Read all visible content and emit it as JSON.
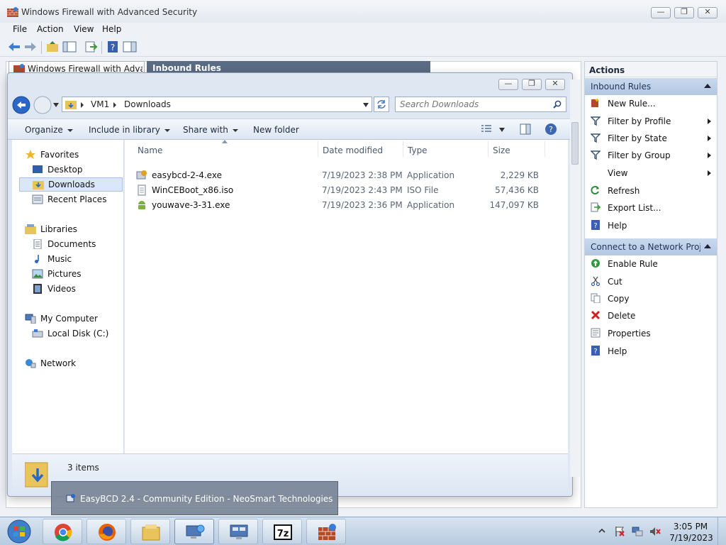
{
  "mmc": {
    "title": "Windows Firewall with Advanced Security",
    "menu": [
      "File",
      "Action",
      "View",
      "Help"
    ],
    "tabs": [
      "Windows Firewall with Advance",
      "Inbound Rules"
    ]
  },
  "actions": {
    "header": "Actions",
    "sections": [
      {
        "title": "Inbound Rules",
        "items": [
          {
            "label": "New Rule...",
            "icon": "new-rule-icon"
          },
          {
            "label": "Filter by Profile",
            "icon": "filter-icon",
            "submenu": true
          },
          {
            "label": "Filter by State",
            "icon": "filter-icon",
            "submenu": true
          },
          {
            "label": "Filter by Group",
            "icon": "filter-icon",
            "submenu": true
          },
          {
            "label": "View",
            "icon": "",
            "submenu": true
          },
          {
            "label": "Refresh",
            "icon": "refresh-icon"
          },
          {
            "label": "Export List...",
            "icon": "export-icon"
          },
          {
            "label": "Help",
            "icon": "help-icon"
          }
        ]
      },
      {
        "title": "Connect to a Network Proj...",
        "items": [
          {
            "label": "Enable Rule",
            "icon": "enable-icon"
          },
          {
            "label": "Cut",
            "icon": "cut-icon"
          },
          {
            "label": "Copy",
            "icon": "copy-icon"
          },
          {
            "label": "Delete",
            "icon": "delete-icon"
          },
          {
            "label": "Properties",
            "icon": "properties-icon"
          },
          {
            "label": "Help",
            "icon": "help-icon"
          }
        ]
      }
    ]
  },
  "explorer": {
    "breadcrumb": [
      "VM1",
      "Downloads"
    ],
    "search_placeholder": "Search Downloads",
    "commands": {
      "organize": "Organize",
      "include": "Include in library",
      "share": "Share with",
      "new_folder": "New folder"
    },
    "nav": {
      "favorites": "Favorites",
      "desktop": "Desktop",
      "downloads": "Downloads",
      "recent": "Recent Places",
      "libraries": "Libraries",
      "documents": "Documents",
      "music": "Music",
      "pictures": "Pictures",
      "videos": "Videos",
      "computer": "My Computer",
      "local_disk": "Local Disk (C:)",
      "network": "Network"
    },
    "columns": {
      "name": "Name",
      "date": "Date modified",
      "type": "Type",
      "size": "Size"
    },
    "files": [
      {
        "name": "easybcd-2-4.exe",
        "date": "7/19/2023 2:38 PM",
        "type": "Application",
        "size": "2,229 KB"
      },
      {
        "name": "WinCEBoot_x86.iso",
        "date": "7/19/2023 2:43 PM",
        "type": "ISO File",
        "size": "57,436 KB"
      },
      {
        "name": "youwave-3-31.exe",
        "date": "7/19/2023 2:36 PM",
        "type": "Application",
        "size": "147,097 KB"
      }
    ],
    "item_count": "3 items"
  },
  "preview": {
    "title": "EasyBCD 2.4 - Community Edition - NeoSmart Technologies"
  },
  "taskbar": {
    "apps": [
      "chrome-icon",
      "firefox-icon",
      "explorer-icon",
      "network-tool-icon",
      "remote-desktop-icon",
      "7zip-icon",
      "firewall-icon"
    ],
    "clock": {
      "time": "3:05 PM",
      "date": "7/19/2023"
    }
  },
  "colors": {
    "accent": "#b3c8e3",
    "selection": "#d9e7f8",
    "taskbar": "#c4d4e6"
  }
}
